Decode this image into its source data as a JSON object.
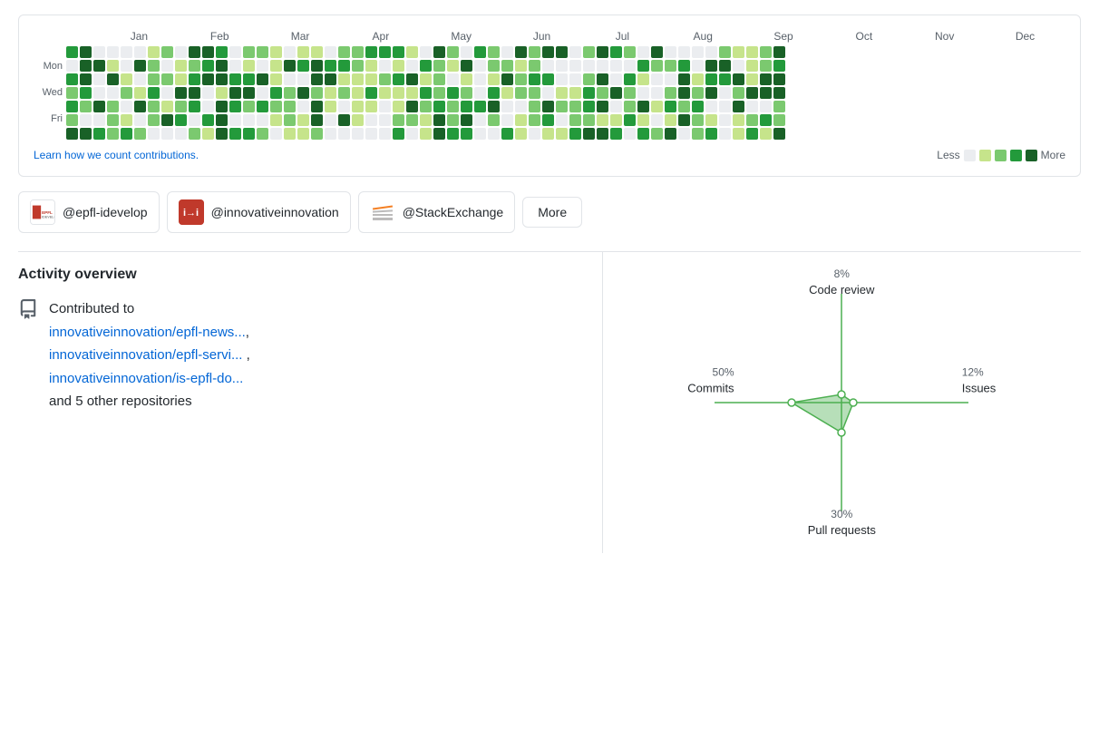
{
  "contrib": {
    "months": [
      "Jan",
      "Feb",
      "Mar",
      "Apr",
      "May",
      "Jun",
      "Jul",
      "Aug",
      "Sep",
      "Oct",
      "Nov",
      "Dec"
    ],
    "day_labels": [
      "",
      "Mon",
      "",
      "Wed",
      "",
      "Fri",
      ""
    ],
    "learn_link": "Learn how we count contributions.",
    "legend_less": "Less",
    "legend_more": "More"
  },
  "orgs": [
    {
      "name": "@epfl-idevelop",
      "abbr": "EPFL",
      "color": "#c0392b",
      "bg": "#fff"
    },
    {
      "name": "@innovativeinnovation",
      "abbr": "i→i",
      "color": "#c0392b",
      "bg": "#c0392b"
    },
    {
      "name": "@StackExchange",
      "abbr": "SE",
      "color": "#f48024",
      "bg": "#fff"
    }
  ],
  "more_label": "More",
  "activity": {
    "title": "Activity overview",
    "icon": "📋",
    "contributed_verb": "Contributed to",
    "repos": [
      {
        "text": "innovativeinnovation/epfl-news...",
        "url": "#"
      },
      {
        "text": "innovativeinnovation/epfl-servi...",
        "url": "#"
      },
      {
        "text": "innovativeinnovation/is-epfl-do...",
        "url": "#"
      }
    ],
    "other_repos": "and 5 other repositories"
  },
  "radar": {
    "labels": [
      {
        "pos": "top",
        "pct": "8%",
        "name": "Code review"
      },
      {
        "pos": "right",
        "pct": "12%",
        "name": "Issues"
      },
      {
        "pos": "bottom",
        "pct": "30%",
        "name": "Pull requests"
      },
      {
        "pos": "left",
        "pct": "50%",
        "name": "Commits"
      }
    ]
  },
  "colors": {
    "accent": "#0366d6",
    "green_dark": "#196127",
    "green_mid": "#239a3b",
    "green_light": "#7bc96f",
    "green_lighter": "#c6e48b",
    "gray_cell": "#ebedf0"
  }
}
